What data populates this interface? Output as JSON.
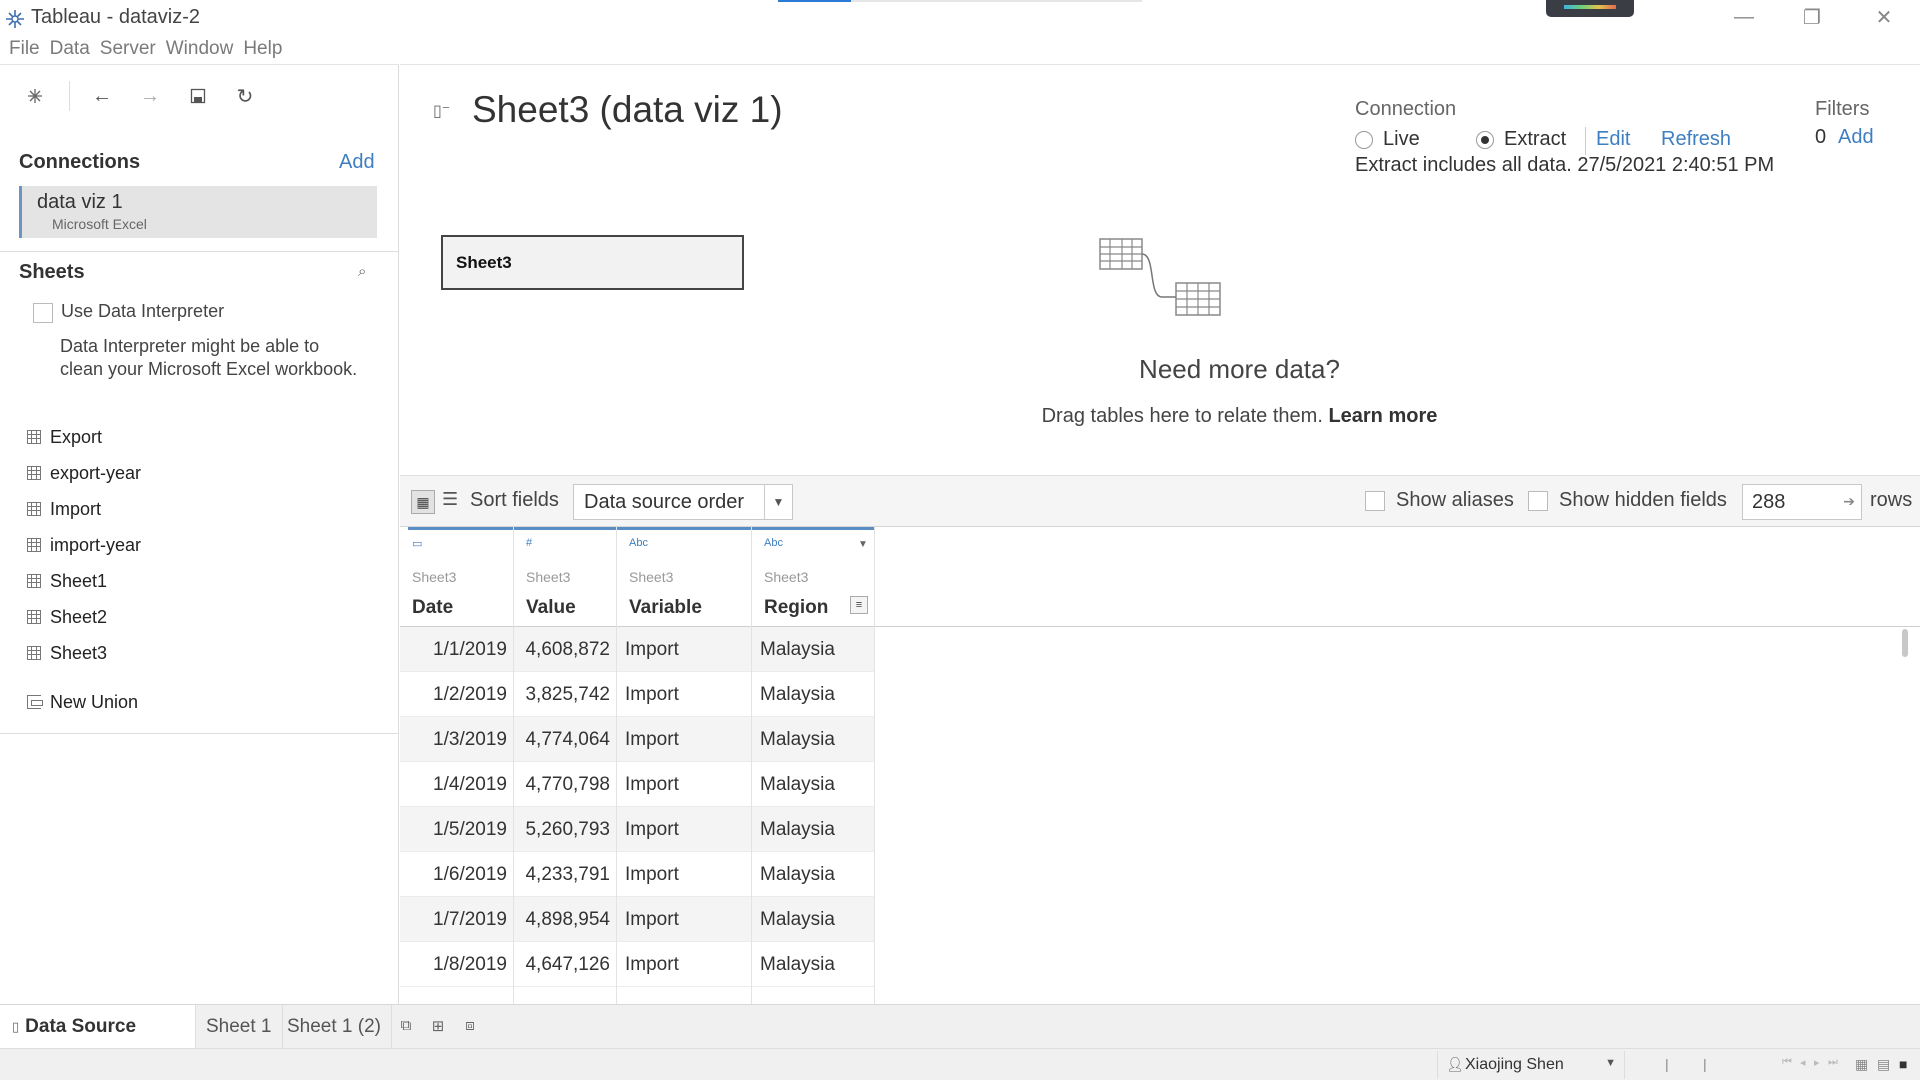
{
  "window": {
    "title": "Tableau - dataviz-2",
    "progress": 0.2,
    "minimize_glyph": "—",
    "restore_glyph": "❐",
    "close_glyph": "✕"
  },
  "menu": [
    "File",
    "Data",
    "Server",
    "Window",
    "Help"
  ],
  "toolbar": {
    "icons": [
      "tableau-logo-icon",
      "back-icon",
      "forward-icon",
      "save-icon",
      "refresh-icon"
    ]
  },
  "connections": {
    "title": "Connections",
    "add_label": "Add",
    "items": [
      {
        "name": "data viz 1",
        "type": "Microsoft Excel"
      }
    ]
  },
  "sheets": {
    "title": "Sheets",
    "interpreter_label": "Use Data Interpreter",
    "interpreter_desc": "Data Interpreter might be able to clean your Microsoft Excel workbook.",
    "items": [
      "Export",
      "export-year",
      "Import",
      "import-year",
      "Sheet1",
      "Sheet2",
      "Sheet3"
    ],
    "new_union": "New Union"
  },
  "canvas": {
    "title": "Sheet3 (data viz 1)",
    "connection_label": "Connection",
    "live_label": "Live",
    "extract_label": "Extract",
    "connection_mode": "Extract",
    "edit_label": "Edit",
    "refresh_label": "Refresh",
    "extract_info": "Extract includes all data. 27/5/2021 2:40:51 PM",
    "filters_label": "Filters",
    "filters_count": "0",
    "filters_add": "Add",
    "table_card": "Sheet3",
    "need_more": "Need more data?",
    "need_more_sub": "Drag tables here to relate them.",
    "learn_more": "Learn more"
  },
  "grid_toolbar": {
    "sort_label": "Sort fields",
    "sort_value": "Data source order",
    "show_aliases": "Show aliases",
    "show_hidden": "Show hidden fields",
    "rows_value": "288",
    "rows_label": "rows"
  },
  "grid": {
    "columns": [
      {
        "type_icon": "date-icon",
        "source": "Sheet3",
        "name": "Date"
      },
      {
        "type_icon": "number-icon",
        "source": "Sheet3",
        "name": "Value"
      },
      {
        "type_icon": "string-icon",
        "source": "Sheet3",
        "name": "Variable"
      },
      {
        "type_icon": "string-icon",
        "source": "Sheet3",
        "name": "Region"
      }
    ],
    "type_glyphs": {
      "date": "▭",
      "number": "#",
      "string": "Abc"
    },
    "rows": [
      [
        "1/1/2019",
        "4,608,872",
        "Import",
        "Malaysia"
      ],
      [
        "1/2/2019",
        "3,825,742",
        "Import",
        "Malaysia"
      ],
      [
        "1/3/2019",
        "4,774,064",
        "Import",
        "Malaysia"
      ],
      [
        "1/4/2019",
        "4,770,798",
        "Import",
        "Malaysia"
      ],
      [
        "1/5/2019",
        "5,260,793",
        "Import",
        "Malaysia"
      ],
      [
        "1/6/2019",
        "4,233,791",
        "Import",
        "Malaysia"
      ],
      [
        "1/7/2019",
        "4,898,954",
        "Import",
        "Malaysia"
      ],
      [
        "1/8/2019",
        "4,647,126",
        "Import",
        "Malaysia"
      ]
    ]
  },
  "tabs": {
    "data_source": "Data Source",
    "sheets": [
      "Sheet 1",
      "Sheet 1 (2)"
    ],
    "new_icons": [
      "new-worksheet-icon",
      "new-dashboard-icon",
      "new-story-icon"
    ]
  },
  "status": {
    "user": "Xiaojing Shen"
  },
  "colors": {
    "accent": "#3e7fc2",
    "column_topline": "#5b8ec5",
    "progress": "#2a7ad6"
  }
}
